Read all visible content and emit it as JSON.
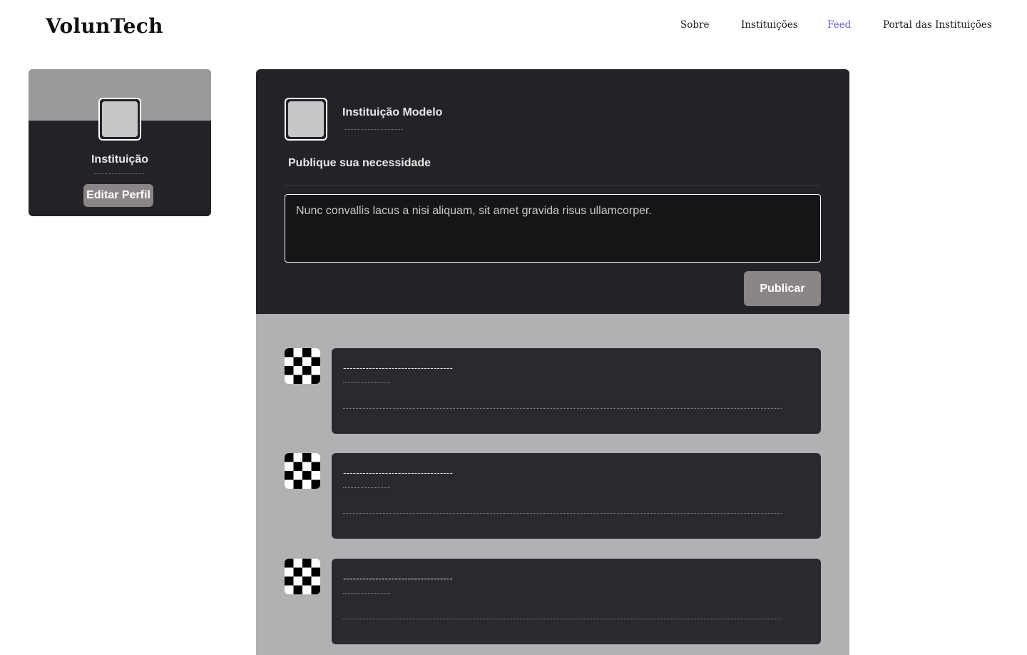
{
  "brand": {
    "name": "VolunTech"
  },
  "nav": {
    "items": [
      {
        "label": "Sobre"
      },
      {
        "label": "Instituições"
      },
      {
        "label": "Feed",
        "active": true
      },
      {
        "label": "Portal das Instituições"
      }
    ],
    "active_color": "#6a5acd"
  },
  "profile_card": {
    "name": "Instituição",
    "edit_button": "Editar Perfil"
  },
  "composer": {
    "org_name": "Instituição Modelo",
    "heading": "Publique sua necessidade",
    "textarea_value": "Nunc convallis lacus a nisi aliquam, sit amet gravida risus ullamcorper.",
    "publish_button": "Publicar"
  },
  "feed": {
    "posts": [
      {
        "title": "----------------------------------"
      },
      {
        "title": "----------------------------------"
      },
      {
        "title": "----------------------------------"
      }
    ]
  },
  "colors": {
    "dark_card": "#232227",
    "button_gray": "#8b8585",
    "feed_background": "#b1b1b3"
  }
}
